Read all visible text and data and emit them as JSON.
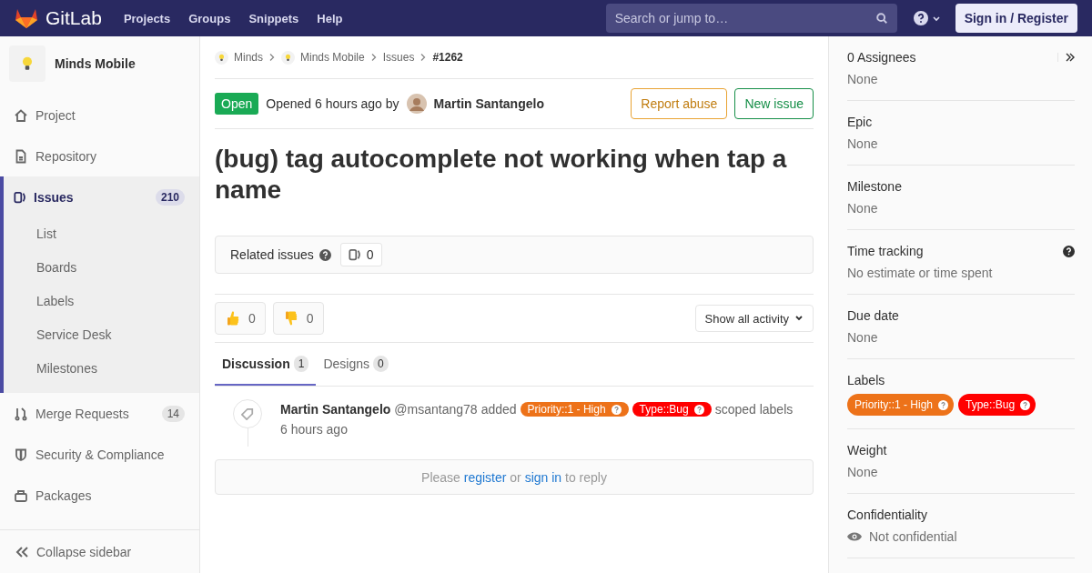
{
  "navbar": {
    "brand": "GitLab",
    "links": [
      "Projects",
      "Groups",
      "Snippets",
      "Help"
    ],
    "search": {
      "placeholder": "Search or jump to…"
    },
    "sign_in": "Sign in / Register"
  },
  "sidebar": {
    "project": "Minds Mobile",
    "items": [
      {
        "label": "Project",
        "kind": "home",
        "selected": false
      },
      {
        "label": "Repository",
        "kind": "doc",
        "selected": false
      },
      {
        "label": "Issues",
        "kind": "issues",
        "count": "210",
        "selected": true,
        "children": [
          {
            "label": "List"
          },
          {
            "label": "Boards"
          },
          {
            "label": "Labels"
          },
          {
            "label": "Service Desk"
          },
          {
            "label": "Milestones"
          }
        ]
      },
      {
        "label": "Merge Requests",
        "kind": "merge",
        "count": "14",
        "selected": false
      },
      {
        "label": "Security & Compliance",
        "kind": "shield",
        "selected": false
      },
      {
        "label": "Packages",
        "kind": "package",
        "selected": false
      }
    ],
    "collapse": "Collapse sidebar"
  },
  "breadcrumbs": [
    {
      "label": "Minds",
      "kind": "avatar"
    },
    {
      "label": "Minds Mobile",
      "kind": "avatar"
    },
    {
      "label": "Issues",
      "kind": "plain"
    },
    {
      "label": "#1262",
      "kind": "current"
    }
  ],
  "issue": {
    "status": "Open",
    "opened": "Opened 6 hours ago by",
    "author": "Martin Santangelo",
    "buttons": [
      {
        "label": "Report abuse",
        "kind": "warning"
      },
      {
        "label": "New issue",
        "kind": "success"
      }
    ],
    "title": "(bug) tag autocomplete not working when tap a name"
  },
  "related": {
    "label": "Related issues",
    "count": "0"
  },
  "awards": [
    {
      "kind": "thumbsup",
      "count": "0"
    },
    {
      "kind": "thumbsdown",
      "count": "0"
    }
  ],
  "activity_filter": "Show all activity",
  "tabs": [
    {
      "label": "Discussion",
      "count": "1",
      "selected": true
    },
    {
      "label": "Designs",
      "count": "0",
      "selected": false
    }
  ],
  "note": {
    "author": "Martin Santangelo",
    "handle": "@msantang78",
    "action": "added",
    "labels": [
      {
        "text": "Priority::1 - High",
        "color": "#ed7219"
      },
      {
        "text": "Type::Bug",
        "color": "#ff0000"
      }
    ],
    "suffix": "scoped labels",
    "time": "6 hours ago"
  },
  "reply": {
    "before": "Please",
    "link1": "register",
    "middle": "or",
    "link2": "sign in",
    "after": "to reply"
  },
  "right_sidebar": [
    {
      "kind": "assignees",
      "title": "0 Assignees",
      "value": "None"
    },
    {
      "kind": "text",
      "title": "Epic",
      "value": "None"
    },
    {
      "kind": "text",
      "title": "Milestone",
      "value": "None"
    },
    {
      "kind": "help",
      "title": "Time tracking",
      "value": "No estimate or time spent"
    },
    {
      "kind": "text",
      "title": "Due date",
      "value": "None"
    },
    {
      "kind": "labels",
      "title": "Labels",
      "labels": [
        {
          "text": "Priority::1 - High",
          "color": "#ed7219"
        },
        {
          "text": "Type::Bug",
          "color": "#ff0000"
        }
      ]
    },
    {
      "kind": "text",
      "title": "Weight",
      "value": "None"
    },
    {
      "kind": "confidential",
      "title": "Confidentiality",
      "value": "Not confidential"
    }
  ]
}
